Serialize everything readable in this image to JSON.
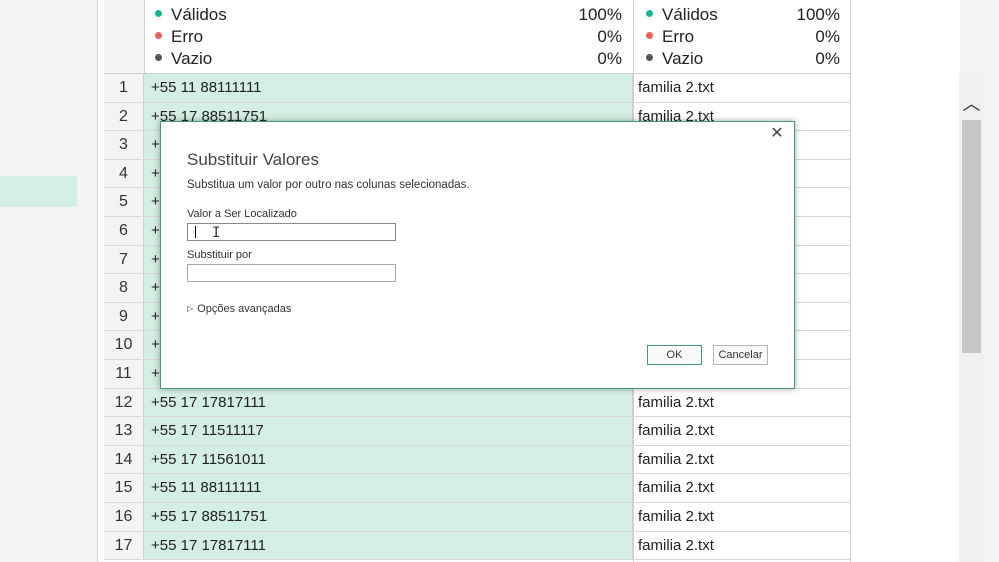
{
  "column_quality": {
    "col1": [
      {
        "label": "Válidos",
        "pct": "100%",
        "color": "#1eb492"
      },
      {
        "label": "Erro",
        "pct": "0%",
        "color": "#e8605c"
      },
      {
        "label": "Vazio",
        "pct": "0%",
        "color": "#555555"
      }
    ],
    "col2": [
      {
        "label": "Válidos",
        "pct": "100%",
        "color": "#1eb492"
      },
      {
        "label": "Erro",
        "pct": "0%",
        "color": "#e8605c"
      },
      {
        "label": "Vazio",
        "pct": "0%",
        "color": "#555555"
      }
    ]
  },
  "rows": [
    {
      "n": "1",
      "phone": "+55 11 88111111",
      "file": "familia 2.txt"
    },
    {
      "n": "2",
      "phone": "+55 17 88511751",
      "file": "familia 2.txt"
    },
    {
      "n": "3",
      "phone": "+",
      "file": ""
    },
    {
      "n": "4",
      "phone": "+",
      "file": ""
    },
    {
      "n": "5",
      "phone": "+",
      "file": ""
    },
    {
      "n": "6",
      "phone": "+",
      "file": ""
    },
    {
      "n": "7",
      "phone": "+",
      "file": ""
    },
    {
      "n": "8",
      "phone": "+",
      "file": ""
    },
    {
      "n": "9",
      "phone": "+",
      "file": ""
    },
    {
      "n": "10",
      "phone": "+",
      "file": ""
    },
    {
      "n": "11",
      "phone": "+",
      "file": ""
    },
    {
      "n": "12",
      "phone": "+55 17 17817111",
      "file": "familia 2.txt"
    },
    {
      "n": "13",
      "phone": "+55 17 11511117",
      "file": "familia 2.txt"
    },
    {
      "n": "14",
      "phone": "+55 17 11561011",
      "file": "familia 2.txt"
    },
    {
      "n": "15",
      "phone": "+55 11 88111111",
      "file": "familia 2.txt"
    },
    {
      "n": "16",
      "phone": "+55 17 88511751",
      "file": "familia 2.txt"
    },
    {
      "n": "17",
      "phone": "+55 17 17817111",
      "file": "familia 2.txt"
    }
  ],
  "dialog": {
    "title": "Substituir Valores",
    "description": "Substitua um valor por outro nas colunas selecionadas.",
    "find_label": "Valor a Ser Localizado",
    "find_value": "",
    "replace_label": "Substituir por",
    "replace_value": "",
    "advanced_label": "Opções avançadas",
    "ok_label": "OK",
    "cancel_label": "Cancelar",
    "close_glyph": "✕"
  },
  "scrollbar": {
    "up_glyph": "︿"
  }
}
